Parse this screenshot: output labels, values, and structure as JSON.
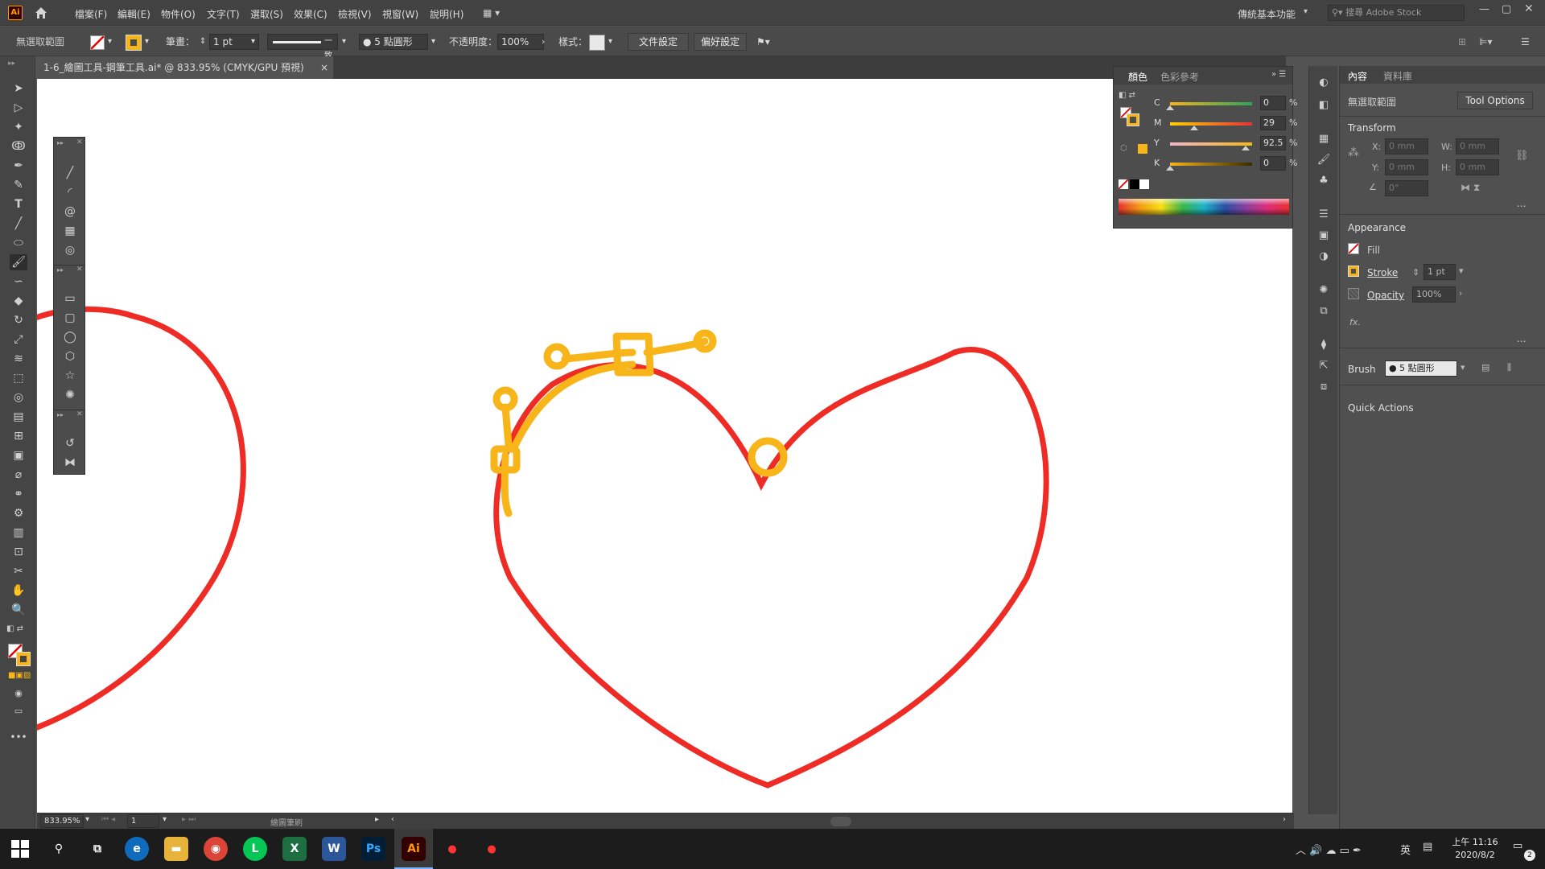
{
  "menubar": {
    "logo": "Ai",
    "items": [
      "檔案(F)",
      "編輯(E)",
      "物件(O)",
      "文字(T)",
      "選取(S)",
      "效果(C)",
      "檢視(V)",
      "視窗(W)",
      "說明(H)"
    ],
    "workspace": "傳統基本功能",
    "search_placeholder": "搜尋 Adobe Stock"
  },
  "control": {
    "selection": "無選取範圍",
    "stroke_label": "筆畫：",
    "stroke_value": "1 pt",
    "profile_label": "一致",
    "brush": "5 點圓形",
    "opacity_label": "不透明度：",
    "opacity_value": "100%",
    "style_label": "樣式：",
    "doc_setup": "文件設定",
    "prefs": "偏好設定"
  },
  "document": {
    "tab_title": "1-6_繪圖工具-鋼筆工具.ai* @ 833.95% (CMYK/GPU 預視)",
    "close": "×"
  },
  "color_panel": {
    "tab_color": "顏色",
    "tab_guide": "色彩參考",
    "channels": [
      {
        "label": "C",
        "value": "0",
        "pct": 0
      },
      {
        "label": "M",
        "value": "29",
        "pct": 29
      },
      {
        "label": "Y",
        "value": "92.5",
        "pct": 92.5
      },
      {
        "label": "K",
        "value": "0",
        "pct": 0
      }
    ],
    "unit": "%",
    "stroke_color": "#f7b519"
  },
  "properties": {
    "tab_props": "內容",
    "tab_libs": "資料庫",
    "no_selection": "無選取範圍",
    "tool_options": "Tool Options",
    "transform": "Transform",
    "x_label": "X:",
    "x_val": "0 mm",
    "y_label": "Y:",
    "y_val": "0 mm",
    "w_label": "W:",
    "w_val": "0 mm",
    "h_label": "H:",
    "h_val": "0 mm",
    "angle_val": "0°",
    "appearance": "Appearance",
    "fill": "Fill",
    "stroke": "Stroke",
    "stroke_val": "1 pt",
    "opacity": "Opacity",
    "opacity_val": "100%",
    "fx": "fx.",
    "brush_label": "Brush",
    "brush_val": "5 點圓形",
    "quick_actions": "Quick Actions",
    "more": "..."
  },
  "status": {
    "zoom": "833.95%",
    "artboard": "1",
    "tool": "繪圖筆刷"
  },
  "taskbar": {
    "time": "上午 11:16",
    "date": "2020/8/2",
    "ime": "英",
    "notif": "2"
  },
  "colors": {
    "heart": "#ee2b24",
    "brush_stroke": "#f7b519"
  }
}
